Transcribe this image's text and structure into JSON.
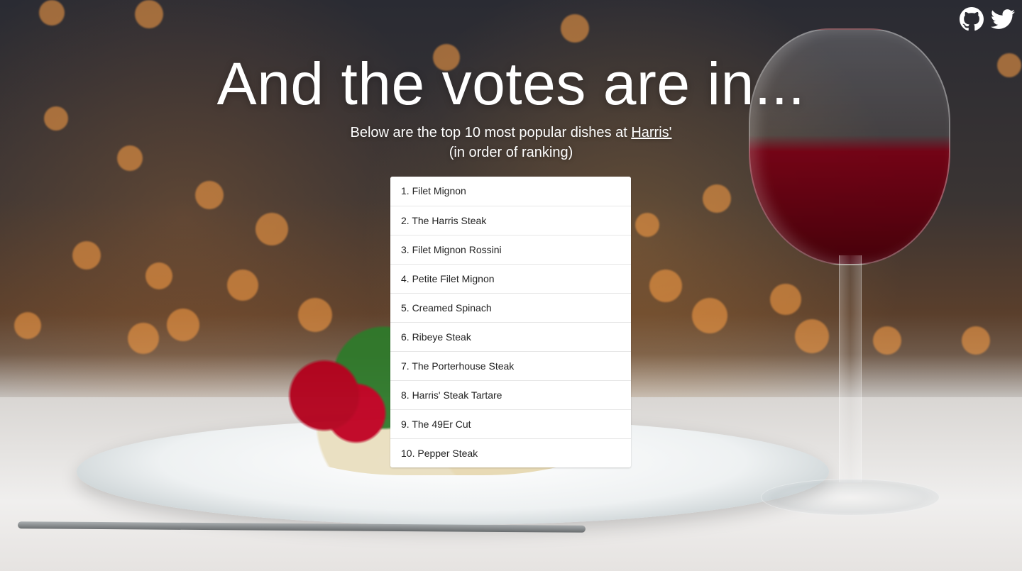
{
  "header": {
    "title": "And the votes are in...",
    "subtitle_prefix": "Below are the top 10 most popular dishes at ",
    "restaurant_link": "Harris'",
    "subtitle_suffix": "(in order of ranking)"
  },
  "social": {
    "github_icon": "github-icon",
    "twitter_icon": "twitter-icon"
  },
  "ranking": {
    "items": [
      "1. Filet Mignon",
      "2. The Harris Steak",
      "3. Filet Mignon Rossini",
      "4. Petite Filet Mignon",
      "5. Creamed Spinach",
      "6. Ribeye Steak",
      "7. The Porterhouse Steak",
      "8. Harris' Steak Tartare",
      "9. The 49Er Cut",
      "10. Pepper Steak"
    ]
  },
  "colors": {
    "text": "#ffffff",
    "list_background": "#ffffff",
    "list_text": "#222222",
    "divider": "#e6e6e6"
  }
}
